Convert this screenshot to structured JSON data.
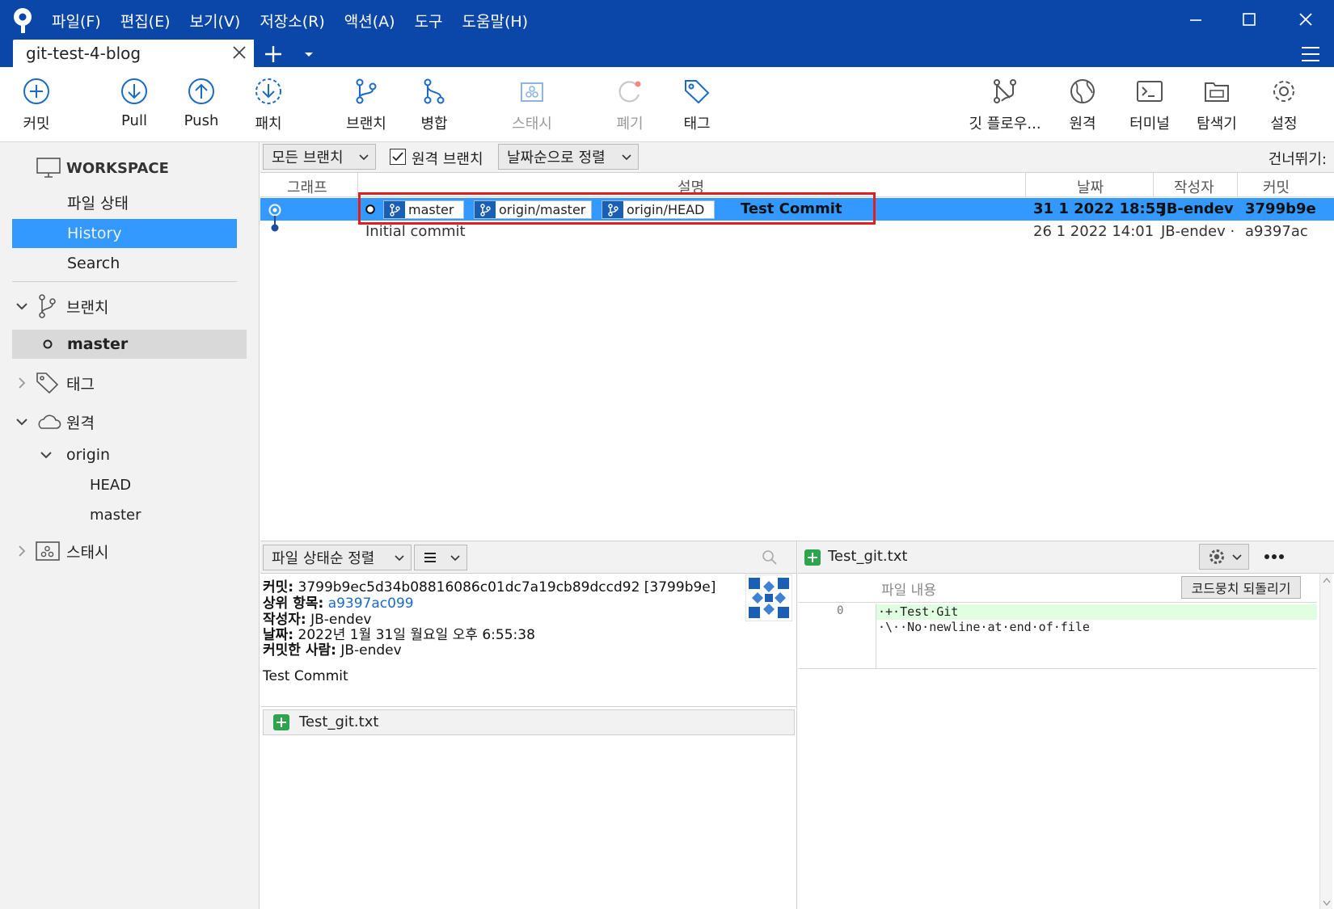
{
  "menu": [
    "파일(F)",
    "편집(E)",
    "보기(V)",
    "저장소(R)",
    "액션(A)",
    "도구",
    "도움말(H)"
  ],
  "tab": {
    "label": "git-test-4-blog"
  },
  "toolbar": {
    "commit": "커밋",
    "pull": "Pull",
    "push": "Push",
    "patch": "패치",
    "branch": "브랜치",
    "merge": "병합",
    "stash": "스태시",
    "discard": "폐기",
    "tag": "태그",
    "gitflow": "깃 플로우...",
    "remote": "원격",
    "terminal": "터미널",
    "explorer": "탐색기",
    "settings": "설정"
  },
  "sidebar": {
    "workspace": "WORKSPACE",
    "file_status": "파일 상태",
    "history": "History",
    "search": "Search",
    "branches": "브랜치",
    "branch_master": "master",
    "tags": "태그",
    "remotes": "원격",
    "origin": "origin",
    "origin_head": "HEAD",
    "origin_master": "master",
    "stash": "스태시"
  },
  "filter": {
    "branches_dd": "모든 브랜치",
    "remote_check": "원격 브랜치",
    "sort_dd": "날짜순으로 정렬",
    "jump": "건너뛰기:"
  },
  "columns": {
    "graph": "그래프",
    "desc": "설명",
    "date": "날짜",
    "author": "작성자",
    "commit": "커밋"
  },
  "commits": [
    {
      "badges": [
        "master",
        "origin/master",
        "origin/HEAD"
      ],
      "message": "Test Commit",
      "date": "31 1 2022 18:55",
      "author": "JB-endev",
      "hash": "3799b9e"
    },
    {
      "badges": [],
      "message": "Initial commit",
      "date": "26 1 2022 14:01",
      "author": "JB-endev ·",
      "hash": "a9397ac"
    }
  ],
  "detail": {
    "sort_dd": "파일 상태순 정렬",
    "commit_label": "커밋:",
    "commit_value": "3799b9ec5d34b08816086c01dc7a19cb89dccd92 [3799b9e]",
    "parent_label": "상위 항목:",
    "parent_value": "a9397ac099",
    "author_label": "작성자:",
    "author_value": "JB-endev",
    "date_label": "날짜:",
    "date_value": "2022년 1월 31일 월요일 오후 6:55:38",
    "committer_label": "커밋한 사람:",
    "committer_value": "JB-endev",
    "message": "Test Commit",
    "file": "Test_git.txt"
  },
  "diff": {
    "file": "Test_git.txt",
    "header": "파일 내용",
    "revert": "코드뭉치 되돌리기",
    "line_no": "0",
    "line1": "·+·Test·Git",
    "line2": "·\\··No·newline·at·end·of·file"
  },
  "colors": {
    "title": "#0b47a8",
    "selection": "#3399ff",
    "sidebar_sel": "#3399ff",
    "redbox": "#e0201f",
    "added": "#2ea44f",
    "diff_add_bg": "#dfffe0"
  }
}
